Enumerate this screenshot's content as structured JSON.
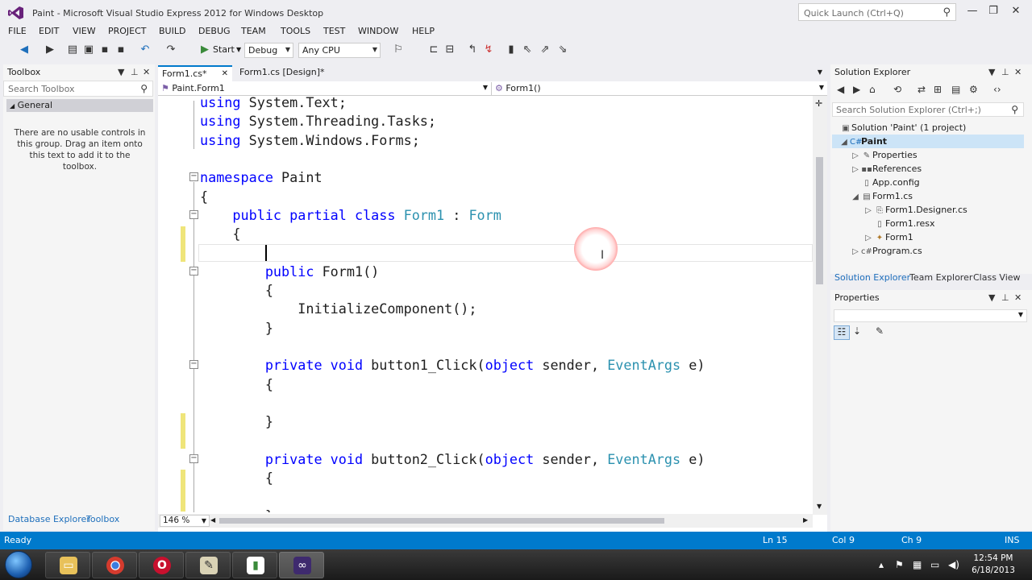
{
  "window": {
    "title": "Paint - Microsoft Visual Studio Express 2012 for Windows Desktop",
    "quick_launch_placeholder": "Quick Launch (Ctrl+Q)"
  },
  "menu": [
    "FILE",
    "EDIT",
    "VIEW",
    "PROJECT",
    "BUILD",
    "DEBUG",
    "TEAM",
    "TOOLS",
    "TEST",
    "WINDOW",
    "HELP"
  ],
  "toolbar": {
    "start_label": "Start",
    "config": "Debug",
    "platform": "Any CPU"
  },
  "toolbox": {
    "title": "Toolbox",
    "search_placeholder": "Search Toolbox",
    "group": "General",
    "empty_message": "There are no usable controls in this group. Drag an item onto this text to add it to the toolbox.",
    "bottom_tabs": [
      "Database Explorer",
      "Toolbox"
    ]
  },
  "editor": {
    "tabs": [
      {
        "label": "Form1.cs*",
        "close": "✕"
      },
      {
        "label": "Form1.cs [Design]*"
      }
    ],
    "nav_class": "Paint.Form1",
    "nav_member": "Form1()",
    "zoom": "146 %",
    "code": [
      [
        {
          "t": "using ",
          "c": "kw"
        },
        {
          "t": "System.Text;",
          "c": "pl"
        }
      ],
      [
        {
          "t": "using ",
          "c": "kw"
        },
        {
          "t": "System.Threading.Tasks;",
          "c": "pl"
        }
      ],
      [
        {
          "t": "using ",
          "c": "kw"
        },
        {
          "t": "System.Windows.Forms;",
          "c": "pl"
        }
      ],
      [],
      [
        {
          "t": "namespace ",
          "c": "kw"
        },
        {
          "t": "Paint",
          "c": "pl"
        }
      ],
      [
        {
          "t": "{",
          "c": "pl"
        }
      ],
      [
        {
          "t": "    public partial class ",
          "c": "kw"
        },
        {
          "t": "Form1",
          "c": "ty"
        },
        {
          "t": " : ",
          "c": "pl"
        },
        {
          "t": "Form",
          "c": "ty"
        }
      ],
      [
        {
          "t": "    {",
          "c": "pl"
        }
      ],
      [],
      [
        {
          "t": "        public ",
          "c": "kw"
        },
        {
          "t": "Form1()",
          "c": "pl"
        }
      ],
      [
        {
          "t": "        {",
          "c": "pl"
        }
      ],
      [
        {
          "t": "            InitializeComponent();",
          "c": "pl"
        }
      ],
      [
        {
          "t": "        }",
          "c": "pl"
        }
      ],
      [],
      [
        {
          "t": "        private void ",
          "c": "kw"
        },
        {
          "t": "button1_Click(",
          "c": "pl"
        },
        {
          "t": "object",
          "c": "kw"
        },
        {
          "t": " sender, ",
          "c": "pl"
        },
        {
          "t": "EventArgs",
          "c": "ty"
        },
        {
          "t": " e)",
          "c": "pl"
        }
      ],
      [
        {
          "t": "        {",
          "c": "pl"
        }
      ],
      [],
      [
        {
          "t": "        }",
          "c": "pl"
        }
      ],
      [],
      [
        {
          "t": "        private void ",
          "c": "kw"
        },
        {
          "t": "button2_Click(",
          "c": "pl"
        },
        {
          "t": "object",
          "c": "kw"
        },
        {
          "t": " sender, ",
          "c": "pl"
        },
        {
          "t": "EventArgs",
          "c": "ty"
        },
        {
          "t": " e)",
          "c": "pl"
        }
      ],
      [
        {
          "t": "        {",
          "c": "pl"
        }
      ],
      [],
      [
        {
          "t": "        }",
          "c": "pl"
        }
      ]
    ]
  },
  "solution_explorer": {
    "title": "Solution Explorer",
    "search_placeholder": "Search Solution Explorer (Ctrl+;)",
    "items": [
      {
        "label": "Solution 'Paint' (1 project)",
        "icon": "solution-icon"
      },
      {
        "label": "Paint",
        "icon": "csharp-project-icon"
      },
      {
        "label": "Properties",
        "icon": "wrench-icon"
      },
      {
        "label": "References",
        "icon": "references-icon"
      },
      {
        "label": "App.config",
        "icon": "config-file-icon"
      },
      {
        "label": "Form1.cs",
        "icon": "form-icon"
      },
      {
        "label": "Form1.Designer.cs",
        "icon": "cs-file-icon"
      },
      {
        "label": "Form1.resx",
        "icon": "resx-file-icon"
      },
      {
        "label": "Form1",
        "icon": "class-icon"
      },
      {
        "label": "Program.cs",
        "icon": "cs-file-icon"
      }
    ],
    "tabs": [
      "Solution Explorer",
      "Team Explorer",
      "Class View"
    ]
  },
  "properties": {
    "title": "Properties"
  },
  "status": {
    "ready": "Ready",
    "line": "Ln 15",
    "col": "Col 9",
    "ch": "Ch 9",
    "mode": "INS"
  },
  "taskbar": {
    "time": "12:54 PM",
    "date": "6/18/2013"
  },
  "colors": {
    "accent": "#007acc",
    "keyword": "#0000ff",
    "type": "#2b91af"
  }
}
